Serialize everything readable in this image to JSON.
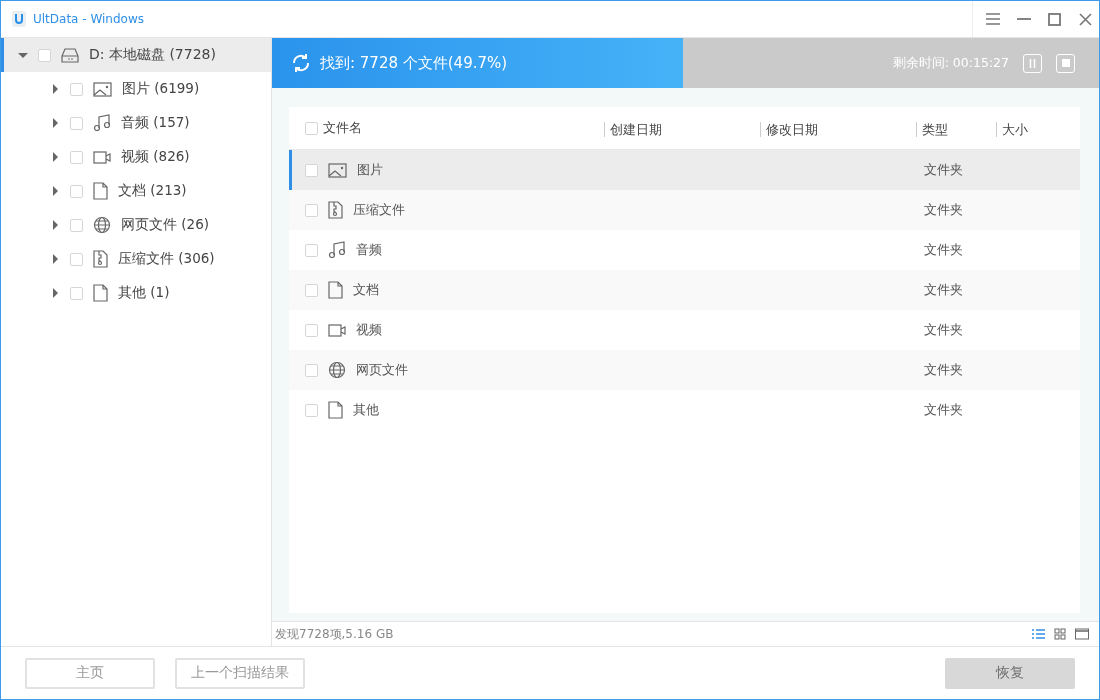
{
  "window": {
    "title": "UltData - Windows"
  },
  "tree": [
    {
      "label": "D: 本地磁盘 (7728)",
      "kind": "drive",
      "expanded": true,
      "selected": true,
      "checked": false,
      "children": [
        {
          "label": "图片 (6199)",
          "kind": "image",
          "expanded": false,
          "selected": false,
          "checked": false
        },
        {
          "label": "音频 (157)",
          "kind": "audio",
          "expanded": false,
          "selected": false,
          "checked": false
        },
        {
          "label": "视频 (826)",
          "kind": "video",
          "expanded": false,
          "selected": false,
          "checked": false
        },
        {
          "label": "文档 (213)",
          "kind": "doc",
          "expanded": false,
          "selected": false,
          "checked": false
        },
        {
          "label": "网页文件 (26)",
          "kind": "web",
          "expanded": false,
          "selected": false,
          "checked": false
        },
        {
          "label": "压缩文件 (306)",
          "kind": "zip",
          "expanded": false,
          "selected": false,
          "checked": false
        },
        {
          "label": "其他 (1)",
          "kind": "doc",
          "expanded": false,
          "selected": false,
          "checked": false
        }
      ]
    }
  ],
  "scan": {
    "status": "找到: 7728 个文件(49.7%)",
    "level": 0.497,
    "remaining": "剩余时间: 00:15:27"
  },
  "table": {
    "columns": [
      "文件名",
      "创建日期",
      "修改日期",
      "类型",
      "大小"
    ],
    "all_checked": false,
    "rows": [
      {
        "name": "图片",
        "kind": "image",
        "type": "文件夹",
        "selected": true,
        "checked": false
      },
      {
        "name": "压缩文件",
        "kind": "zip",
        "type": "文件夹",
        "selected": false,
        "checked": false
      },
      {
        "name": "音频",
        "kind": "audio",
        "type": "文件夹",
        "selected": false,
        "checked": false
      },
      {
        "name": "文档",
        "kind": "doc",
        "type": "文件夹",
        "selected": false,
        "checked": false
      },
      {
        "name": "视频",
        "kind": "video",
        "type": "文件夹",
        "selected": false,
        "checked": false
      },
      {
        "name": "网页文件",
        "kind": "web",
        "type": "文件夹",
        "selected": false,
        "checked": false
      },
      {
        "name": "其他",
        "kind": "doc",
        "type": "文件夹",
        "selected": false,
        "checked": false
      }
    ]
  },
  "status_bar": {
    "summary": "发现7728项,5.16 GB",
    "view_modes": [
      {
        "kind": "list",
        "selected": true
      },
      {
        "kind": "grid",
        "selected": false
      },
      {
        "kind": "preview",
        "selected": false
      }
    ]
  },
  "buttons": [
    {
      "label": "主页",
      "disabled": false
    },
    {
      "label": "上一个扫描结果",
      "disabled": false
    },
    {
      "label": "恢复",
      "disabled": true
    }
  ]
}
